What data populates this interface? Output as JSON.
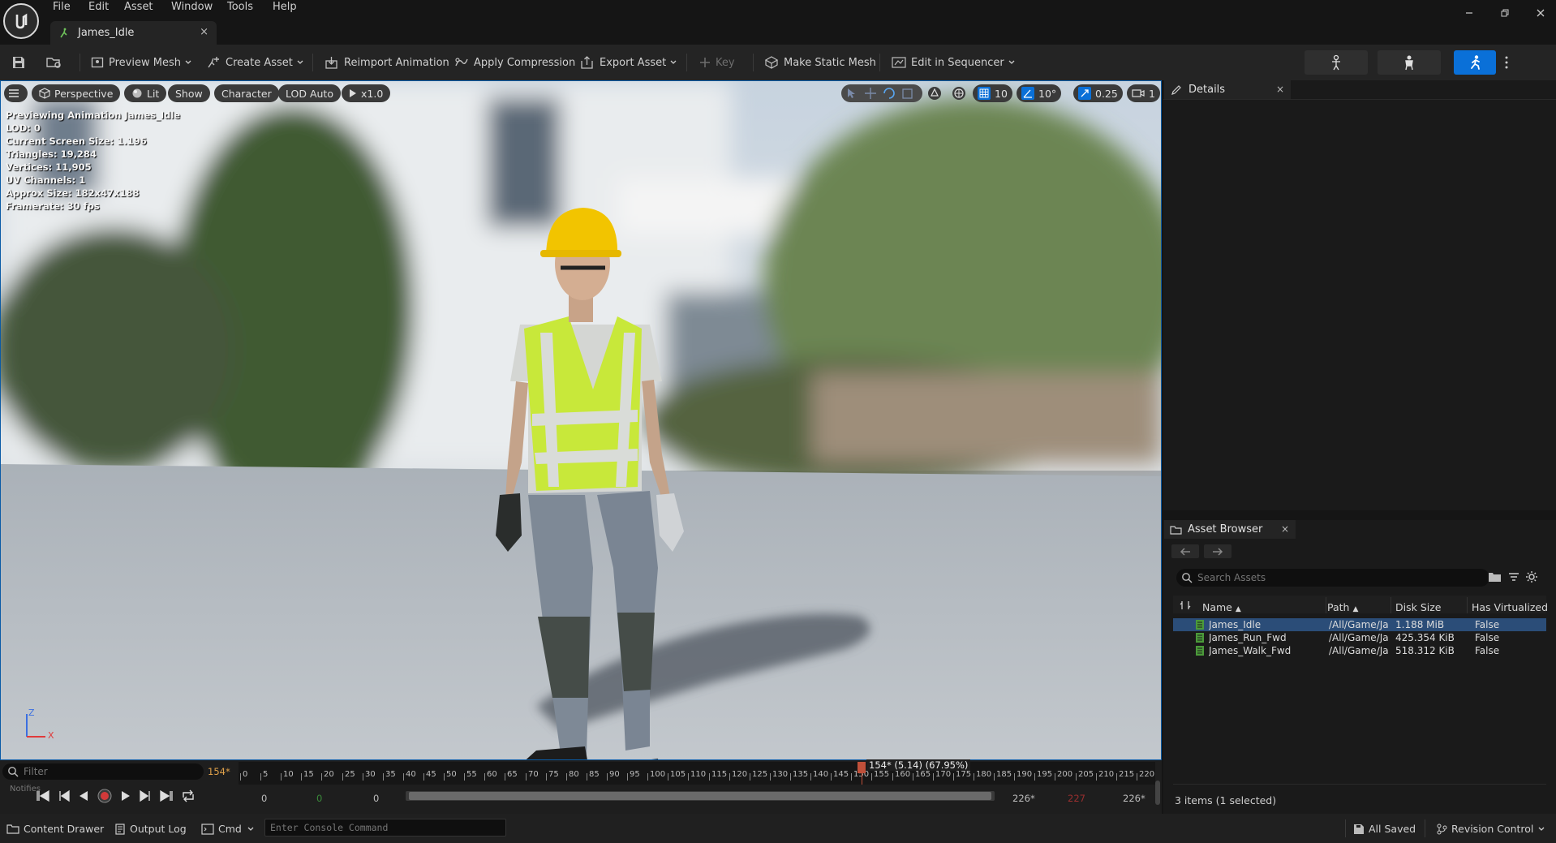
{
  "menu": {
    "items": [
      "File",
      "Edit",
      "Asset",
      "Window",
      "Tools",
      "Help"
    ]
  },
  "doc_tab": {
    "title": "James_Idle",
    "close": "×"
  },
  "toolbar": {
    "preview_mesh": "Preview Mesh",
    "create_asset": "Create Asset",
    "reimport_animation": "Reimport Animation",
    "apply_compression": "Apply Compression",
    "export_asset": "Export Asset",
    "key": "Key",
    "make_static_mesh": "Make Static Mesh",
    "edit_in_sequencer": "Edit in Sequencer"
  },
  "viewport": {
    "perspective": "Perspective",
    "lit": "Lit",
    "show": "Show",
    "character": "Character",
    "lod": "LOD Auto",
    "speed": "x1.0",
    "grid_snap": "10",
    "rot_snap": "10°",
    "scale_snap": "0.25",
    "cam_speed": "1",
    "stats": [
      "Previewing Animation James_Idle",
      "LOD: 0",
      "Current Screen Size: 1.196",
      "Triangles: 19,284",
      "Vertices: 11,905",
      "UV Channels: 1",
      "Approx Size: 182x47x188",
      "Framerate: 30 fps"
    ],
    "axis_z": "Z",
    "axis_x": "X"
  },
  "timeline": {
    "filter_placeholder": "Filter",
    "current_frame": "154*",
    "playhead_label": "154* (5.14) (67.95%)",
    "track_label": "Notifies",
    "ticks": [
      "0",
      "5",
      "10",
      "15",
      "20",
      "25",
      "30",
      "35",
      "40",
      "45",
      "50",
      "55",
      "60",
      "65",
      "70",
      "75",
      "80",
      "85",
      "90",
      "95",
      "100",
      "105",
      "110",
      "115",
      "120",
      "125",
      "130",
      "135",
      "140",
      "145",
      "150",
      "155",
      "160",
      "165",
      "170",
      "175",
      "180",
      "185",
      "190",
      "195",
      "200",
      "205",
      "210",
      "215",
      "220"
    ],
    "range_start_a": "0",
    "range_start_b": "0",
    "range_start_c": "0",
    "range_end_a": "226*",
    "range_end_b": "227",
    "range_end_c": "226*",
    "playhead_fraction": 0.6795
  },
  "details": {
    "title": "Details"
  },
  "asset_browser": {
    "title": "Asset Browser",
    "search_placeholder": "Search Assets",
    "columns": [
      "Name",
      "Path",
      "Disk Size",
      "Has Virtualized"
    ],
    "rows": [
      {
        "name": "James_Idle",
        "path": "/All/Game/Ja",
        "size": "1.188 MiB",
        "virt": "False",
        "selected": true
      },
      {
        "name": "James_Run_Fwd",
        "path": "/All/Game/Ja",
        "size": "425.354 KiB",
        "virt": "False",
        "selected": false
      },
      {
        "name": "James_Walk_Fwd",
        "path": "/All/Game/Ja",
        "size": "518.312 KiB",
        "virt": "False",
        "selected": false
      }
    ],
    "footer": "3 items (1 selected)"
  },
  "statusbar": {
    "content_drawer": "Content Drawer",
    "output_log": "Output Log",
    "cmd": "Cmd",
    "console_placeholder": "Enter Console Command",
    "all_saved": "All Saved",
    "revision_control": "Revision Control"
  },
  "colors": {
    "accent": "#0a70d8",
    "selection": "#2b4d78",
    "playhead": "#c0503a",
    "vest": "#c8e83a",
    "helmet": "#f2c400"
  }
}
